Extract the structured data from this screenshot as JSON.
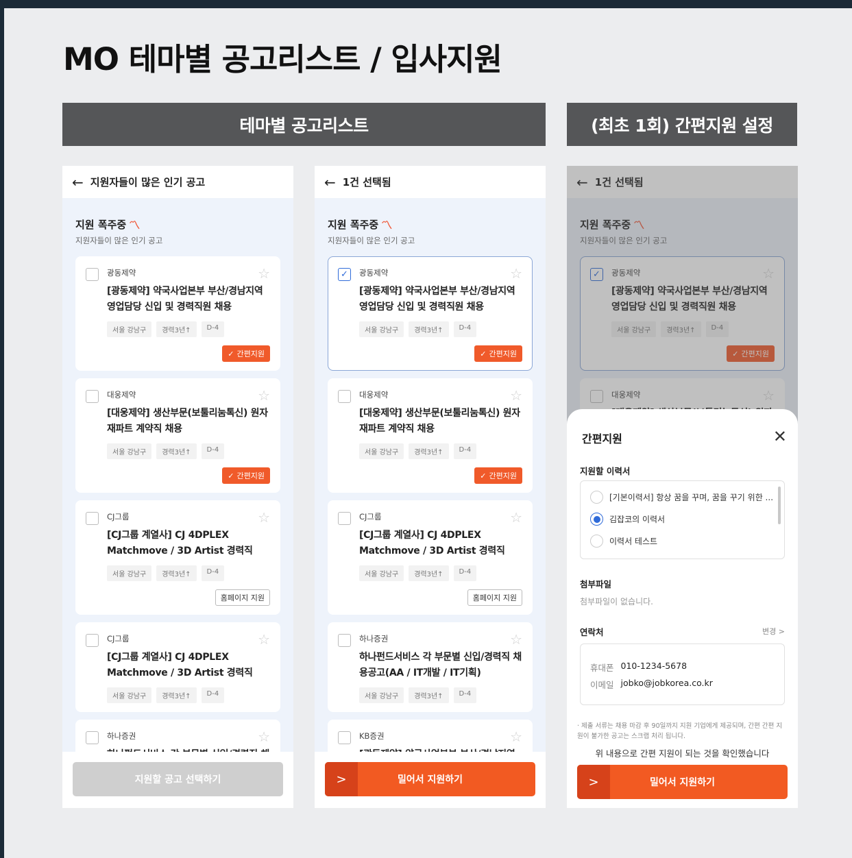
{
  "page_title": "MO 테마별 공고리스트 / 입사지원",
  "sections": {
    "left": "테마별 공고리스트",
    "right": "(최초 1회) 간편지원 설정"
  },
  "screens": [
    {
      "header": "지원자들이 많은 인기 공고",
      "section_title": "지원 폭주중",
      "section_sub": "지원자들이 많은 인기 공고",
      "cards": [
        {
          "company": "광동제약",
          "title": "[광동제약] 약국사업본부 부산/경남지역 영업담당 신입 및 경력직원 채용",
          "tags": [
            "서울 강남구",
            "경력3년↑",
            "D-4"
          ],
          "action": "간편지원",
          "selected": false
        },
        {
          "company": "대웅제약",
          "title": "[대웅제약] 생산부문(보툴리눔톡신) 원자재파트 계약직 채용",
          "tags": [
            "서울 강남구",
            "경력3년↑",
            "D-4"
          ],
          "action": "간편지원",
          "selected": false
        },
        {
          "company": "CJ그룹",
          "title": "[CJ그룹 계열사] CJ 4DPLEX Matchmove / 3D Artist 경력직",
          "tags": [
            "서울 강남구",
            "경력3년↑",
            "D-4"
          ],
          "action": "홈페이지 지원",
          "selected": false
        },
        {
          "company": "CJ그룹",
          "title": "[CJ그룹 계열사] CJ 4DPLEX Matchmove / 3D Artist 경력직",
          "tags": [
            "서울 강남구",
            "경력3년↑",
            "D-4"
          ],
          "action": "",
          "selected": false
        },
        {
          "company": "하나증권",
          "title": "하나펀드서비스 각 부문별 신입/경력직 채용공고(AA / IT개발 / IT기획)",
          "tags": [],
          "action": "",
          "selected": false
        }
      ],
      "submit": "지원할 공고 선택하기"
    },
    {
      "header": "1건 선택됨",
      "section_title": "지원 폭주중",
      "section_sub": "지원자들이 많은 인기 공고",
      "cards": [
        {
          "company": "광동제약",
          "title": "[광동제약] 약국사업본부 부산/경남지역 영업담당 신입 및 경력직원 채용",
          "tags": [
            "서울 강남구",
            "경력3년↑",
            "D-4"
          ],
          "action": "간편지원",
          "selected": true
        },
        {
          "company": "대웅제약",
          "title": "[대웅제약] 생산부문(보툴리눔톡신) 원자재파트 계약직 채용",
          "tags": [
            "서울 강남구",
            "경력3년↑",
            "D-4"
          ],
          "action": "간편지원",
          "selected": false
        },
        {
          "company": "CJ그룹",
          "title": "[CJ그룹 계열사] CJ 4DPLEX Matchmove / 3D Artist 경력직",
          "tags": [
            "서울 강남구",
            "경력3년↑",
            "D-4"
          ],
          "action": "홈페이지 지원",
          "selected": false
        },
        {
          "company": "하나증권",
          "title": "하나펀드서비스 각 부문별 신입/경력직 채용공고(AA / IT개발 / IT기획)",
          "tags": [
            "서울 강남구",
            "경력3년↑",
            "D-4"
          ],
          "action": "",
          "selected": false
        },
        {
          "company": "KB증권",
          "title": "[광동제약] 약국사업본부 부산/경남지역 영업담당 신입 및 경력직원 채용",
          "tags": [],
          "action": "",
          "selected": false
        }
      ],
      "submit": "밀어서 지원하기"
    },
    {
      "header": "1건 선택됨",
      "section_title": "지원 폭주중",
      "section_sub": "지원자들이 많은 인기 공고",
      "cards": [
        {
          "company": "광동제약",
          "title": "[광동제약] 약국사업본부 부산/경남지역 영업담당 신입 및 경력직원 채용",
          "tags": [
            "서울 강남구",
            "경력3년↑",
            "D-4"
          ],
          "action": "간편지원",
          "selected": true
        },
        {
          "company": "대웅제약",
          "title": "[대웅제약] 생산부문(보툴리눔톡신) 원자재파트 계약직 채용",
          "tags": [],
          "action": "",
          "selected": false
        }
      ],
      "submit": "밀어서 지원하기"
    }
  ],
  "sheet": {
    "title": "간편지원",
    "resume_label": "지원할 이력서",
    "resumes": [
      {
        "label": "[기본이력서] 항상 꿈을 꾸며, 꿈을 꾸기 위한 ...",
        "checked": false
      },
      {
        "label": "김잡코의 이력서",
        "checked": true
      },
      {
        "label": "이력서 테스트",
        "checked": false
      }
    ],
    "attach_label": "첨부파일",
    "attach_empty": "첨부파일이 없습니다.",
    "contact_label": "연락처",
    "change": "변경 >",
    "phone_key": "휴대폰",
    "phone": "010-1234-5678",
    "email_key": "이메일",
    "email": "jobko@jobkorea.co.kr",
    "notice": "· 제출 서류는 채용 마감 후 90일까지 지원 기업에게 제공되며, 간편 간편 지원이 불가한 공고는 스크랩 처리 됩니다.",
    "confirm": "위 내용으로 간편 지원이 되는 것을 확인했습니다",
    "submit": "밀어서 지원하기"
  },
  "colors": {
    "accent": "#f25a22",
    "selected": "#2f6bd9",
    "header_bg": "#555658"
  }
}
